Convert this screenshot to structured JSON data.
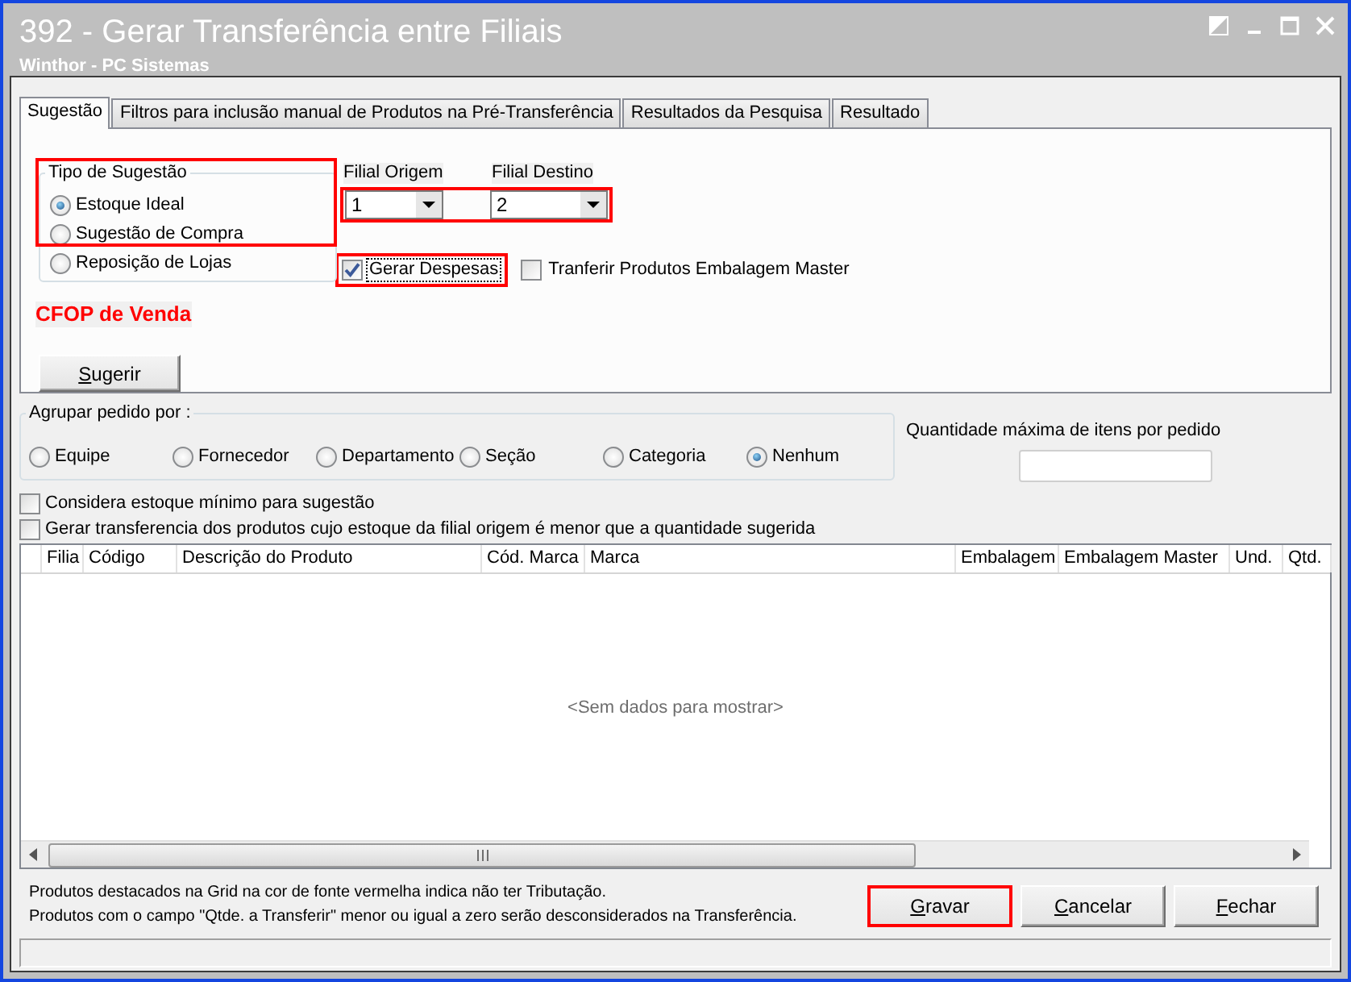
{
  "window": {
    "title": "392 - Gerar Transferência entre Filiais",
    "subtitle": "Winthor - PC Sistemas"
  },
  "tabs": [
    {
      "label": "Sugestão",
      "selected": true
    },
    {
      "label": "Filtros para inclusão manual de Produtos na Pré-Transferência",
      "selected": false
    },
    {
      "label": "Resultados da Pesquisa",
      "selected": false
    },
    {
      "label": "Resultado",
      "selected": false
    }
  ],
  "tipo_sugestao": {
    "title": "Tipo de Sugestão",
    "highlighted": true,
    "options": [
      {
        "label": "Estoque Ideal",
        "selected": true
      },
      {
        "label": "Sugestão de Compra",
        "selected": false
      },
      {
        "label": "Reposição de Lojas",
        "selected": false
      }
    ]
  },
  "filiais": {
    "highlighted": true,
    "fields": [
      {
        "label": "Filial Origem",
        "value": "1"
      },
      {
        "label": "Filial Destino",
        "value": "2"
      }
    ]
  },
  "options": [
    {
      "label": "Gerar Despesas",
      "checked": true,
      "highlighted": true,
      "focused": true
    },
    {
      "label": "Tranferir Produtos Embalagem Master",
      "checked": false,
      "highlighted": false,
      "focused": false
    }
  ],
  "cfop_label": "CFOP de Venda",
  "suggest_button": {
    "label": "Sugerir",
    "mnemonic_underlined": true
  },
  "group_by": {
    "title": "Agrupar pedido por :",
    "options": [
      {
        "label": "Equipe",
        "selected": false
      },
      {
        "label": "Fornecedor",
        "selected": false
      },
      {
        "label": "Departamento",
        "selected": false
      },
      {
        "label": "Seção",
        "selected": false
      },
      {
        "label": "Categoria",
        "selected": false
      },
      {
        "label": "Nenhum",
        "selected": true
      }
    ]
  },
  "max_items": {
    "label": "Quantidade máxima de itens por pedido"
  },
  "checks": [
    {
      "label": "Considera estoque mínimo para sugestão",
      "checked": false
    },
    {
      "label": "Gerar transferencia dos produtos cujo estoque da filial origem é menor que a quantidade sugerida",
      "checked": false
    }
  ],
  "grid": {
    "columns": [
      "Filia",
      "Código",
      "Descrição do Produto",
      "Cód. Marca",
      "Marca",
      "Embalagem",
      "Embalagem Master",
      "Und.",
      "Qtd."
    ],
    "empty_message": "<Sem dados para mostrar>"
  },
  "notes": [
    "Produtos destacados na Grid na cor de fonte vermelha indica não ter Tributação.",
    "Produtos com o campo \"Qtde. a Transferir\" menor ou igual a zero serão desconsiderados na Transferência."
  ],
  "buttons": [
    {
      "label": "Gravar",
      "highlighted": true,
      "mnemonic_underlined": true
    },
    {
      "label": "Cancelar",
      "highlighted": false,
      "mnemonic_underlined": true
    },
    {
      "label": "Fechar",
      "highlighted": false,
      "mnemonic_underlined": true
    }
  ]
}
